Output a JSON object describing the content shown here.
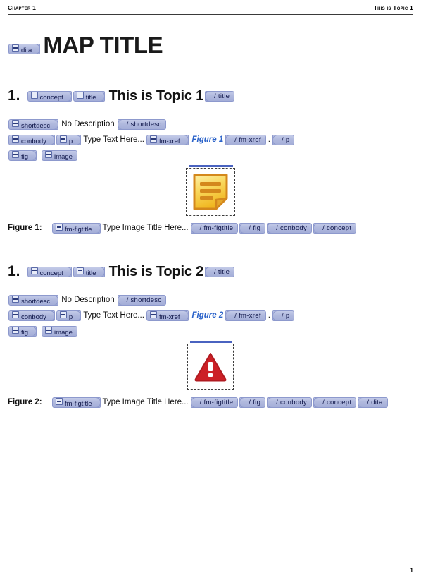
{
  "header": {
    "left": "Chapter 1",
    "right": "This is Topic 1"
  },
  "footer": {
    "page_number": "1"
  },
  "map": {
    "open_tag": "dita",
    "title": "MAP TITLE"
  },
  "colors": {
    "tag_fill": "#aeb7dd",
    "tag_border": "#8d99cd",
    "tag_text": "#11184b",
    "xref_blue": "#2a62c9",
    "rule": "#3a3a3a",
    "note_icon": "#f5c93f",
    "warning_icon": "#cc2026"
  },
  "topics": [
    {
      "number": "1.",
      "open_concept": "concept",
      "open_title": "title",
      "title": "This is Topic 1",
      "close_title": "/ title",
      "shortdesc": {
        "open": "shortdesc",
        "text": "No Description",
        "close": "/ shortdesc"
      },
      "body": {
        "open_conbody": "conbody",
        "open_p": "p",
        "text": "Type Text Here...",
        "open_xref": "fm-xref",
        "xref_text": "Figure 1",
        "close_xref": "/ fm-xref",
        "period": ".",
        "close_p": "/ p"
      },
      "figure": {
        "open_fig": "fig",
        "image_tag": "image",
        "icon": "note-icon",
        "caption_label": "Figure 1:",
        "open_figtitle": "fm-figtitle",
        "caption_text": "Type Image Title Here...",
        "close_figtitle": "/ fm-figtitle",
        "close_fig": "/ fig",
        "close_conbody": "/ conbody",
        "close_concept": "/ concept",
        "close_dita": null
      }
    },
    {
      "number": "1.",
      "open_concept": "concept",
      "open_title": "title",
      "title": "This is Topic 2",
      "close_title": "/ title",
      "shortdesc": {
        "open": "shortdesc",
        "text": "No Description",
        "close": "/ shortdesc"
      },
      "body": {
        "open_conbody": "conbody",
        "open_p": "p",
        "text": "Type Text Here...",
        "open_xref": "fm-xref",
        "xref_text": "Figure 2",
        "close_xref": "/ fm-xref",
        "period": ".",
        "close_p": "/ p"
      },
      "figure": {
        "open_fig": "fig",
        "image_tag": "image",
        "icon": "warning-icon",
        "caption_label": "Figure 2:",
        "open_figtitle": "fm-figtitle",
        "caption_text": "Type Image Title Here...",
        "close_figtitle": "/ fm-figtitle",
        "close_fig": "/ fig",
        "close_conbody": "/ conbody",
        "close_concept": "/ concept",
        "close_dita": "/ dita"
      }
    }
  ]
}
